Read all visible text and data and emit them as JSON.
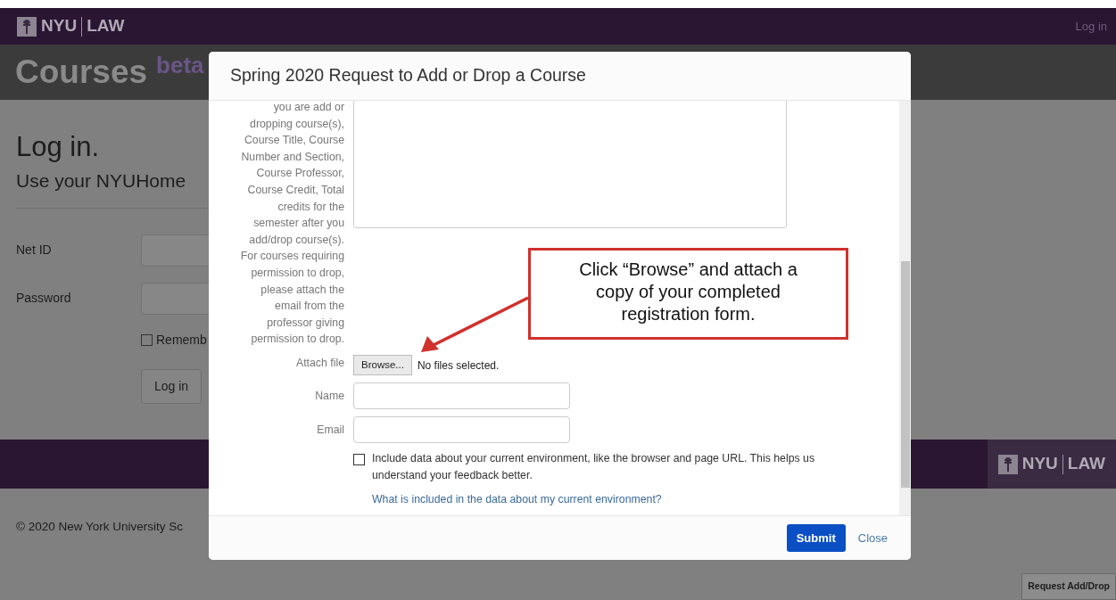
{
  "navbar": {
    "logo": {
      "left": "NYU",
      "right": "LAW"
    },
    "login_link": "Log in"
  },
  "header": {
    "title": "Courses",
    "badge": "beta"
  },
  "login": {
    "heading": "Log in.",
    "subheading": "Use your NYUHome",
    "fields": [
      {
        "label": "Net ID"
      },
      {
        "label": "Password"
      }
    ],
    "remember": {
      "label": "Rememb",
      "checked": false
    },
    "button": "Log in"
  },
  "footer": {
    "logo": {
      "left": "NYU",
      "right": "LAW"
    },
    "copyright": "© 2020 New York University Sc"
  },
  "request_button": "Request Add/Drop",
  "modal": {
    "title": "Spring 2020 Request to Add or Drop a Course",
    "description_lines": [
      "you are add or",
      "dropping course(s),",
      "Course Title, Course",
      "Number and Section,",
      "Course Professor,",
      "Course Credit, Total",
      "credits for the",
      "semester after you",
      "add/drop course(s).",
      "For courses requiring",
      "permission to drop,",
      "please attach the",
      "email from the",
      "professor giving",
      "permission to drop."
    ],
    "attach": {
      "label": "Attach file",
      "button": "Browse...",
      "status": "No files selected."
    },
    "fields": [
      {
        "label": "Name"
      },
      {
        "label": "Email"
      }
    ],
    "include": {
      "checked": false,
      "text": "Include data about your current environment, like the browser and page URL. This helps us understand your feedback better."
    },
    "info_link": "What is included in the data about my current environment?",
    "buttons": {
      "submit": "Submit",
      "close": "Close"
    }
  },
  "callout": {
    "lines": [
      "Click “Browse” and attach a",
      "copy of your completed",
      "registration form."
    ]
  }
}
